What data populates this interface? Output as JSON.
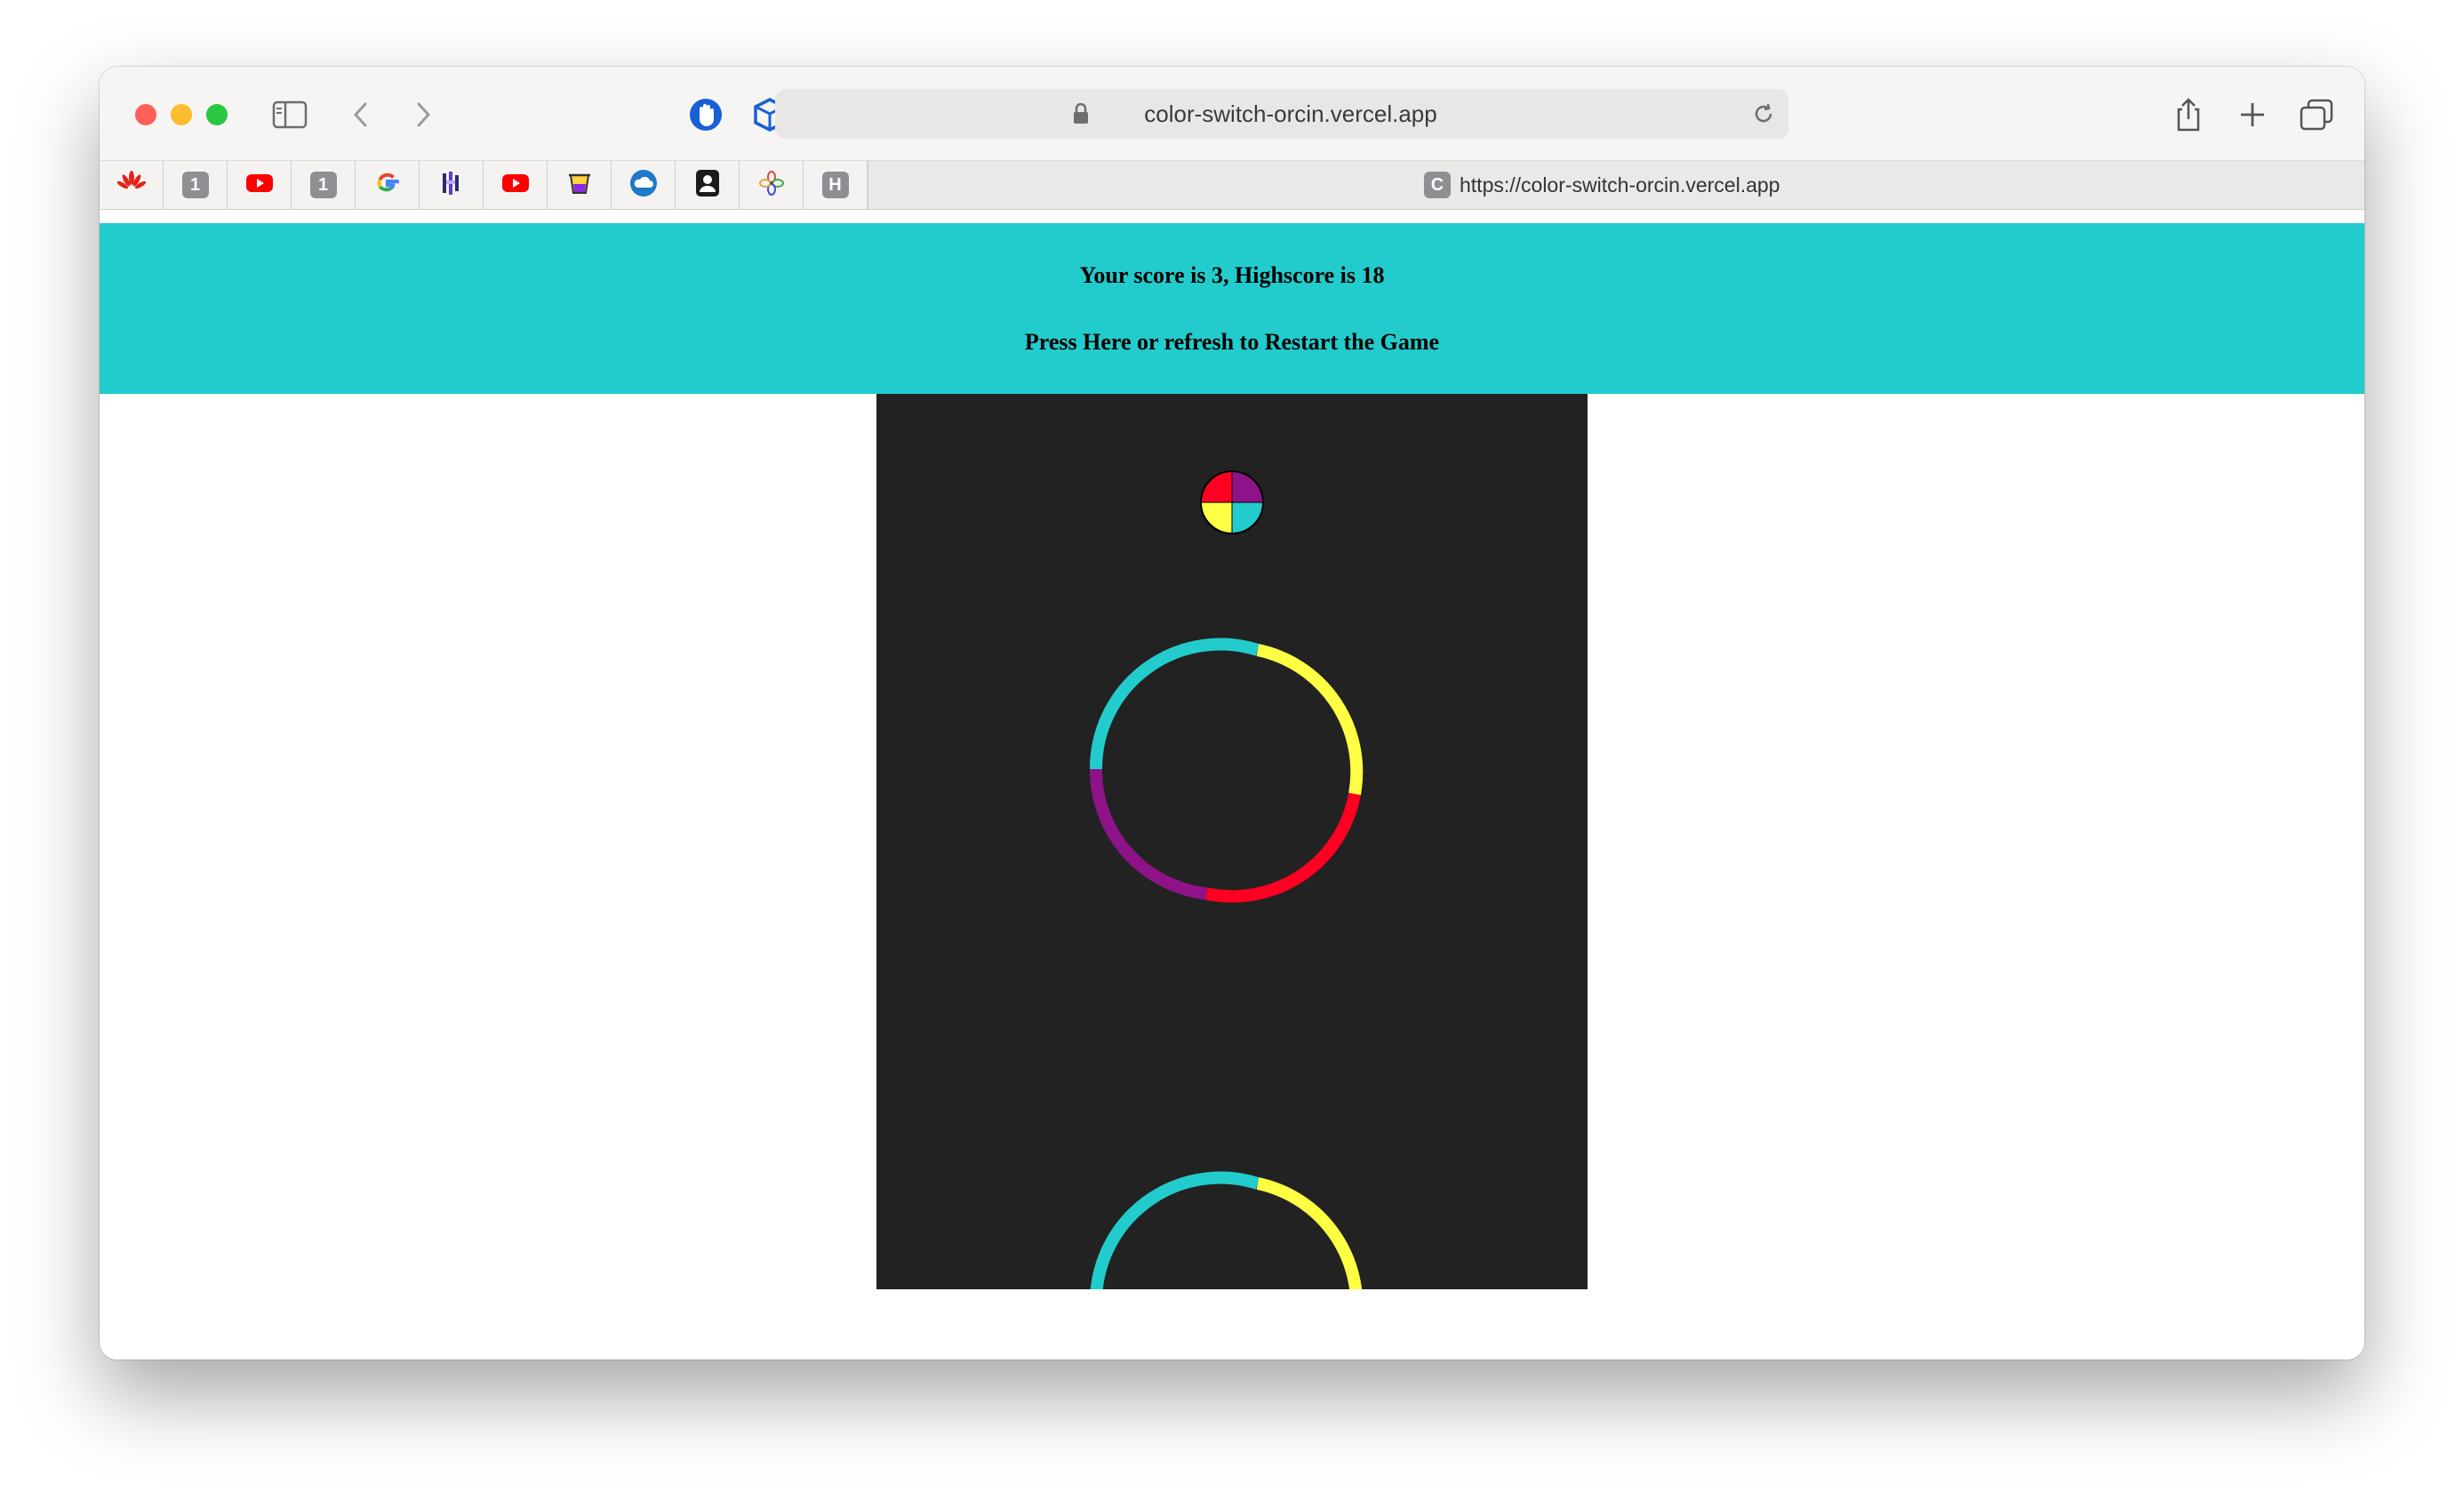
{
  "browser": {
    "url_display": "color-switch-orcin.vercel.app",
    "active_tab": {
      "favicon_letter": "C",
      "title": "https://color-switch-orcin.vercel.app"
    },
    "favorites": [
      {
        "icon": "huawei-icon"
      },
      {
        "icon": "number-1-icon",
        "text": "1"
      },
      {
        "icon": "youtube-icon"
      },
      {
        "icon": "number-1-icon",
        "text": "1"
      },
      {
        "icon": "google-icon"
      },
      {
        "icon": "bars-logo-icon"
      },
      {
        "icon": "youtube-icon"
      },
      {
        "icon": "cup-icon"
      },
      {
        "icon": "cloud-icon"
      },
      {
        "icon": "contact-icon"
      },
      {
        "icon": "flower-icon"
      },
      {
        "icon": "letter-h-icon",
        "text": "H"
      }
    ]
  },
  "page": {
    "score_text": "Your score is 3, Highscore is 18",
    "restart_text": "Press Here or refresh to Restart the Game",
    "score": 3,
    "highscore": 18
  },
  "game": {
    "background": "#222222",
    "colors": {
      "cyan": "#22cccc",
      "yellow": "#ffff44",
      "red": "#ff0022",
      "purple": "#8e1388"
    }
  }
}
